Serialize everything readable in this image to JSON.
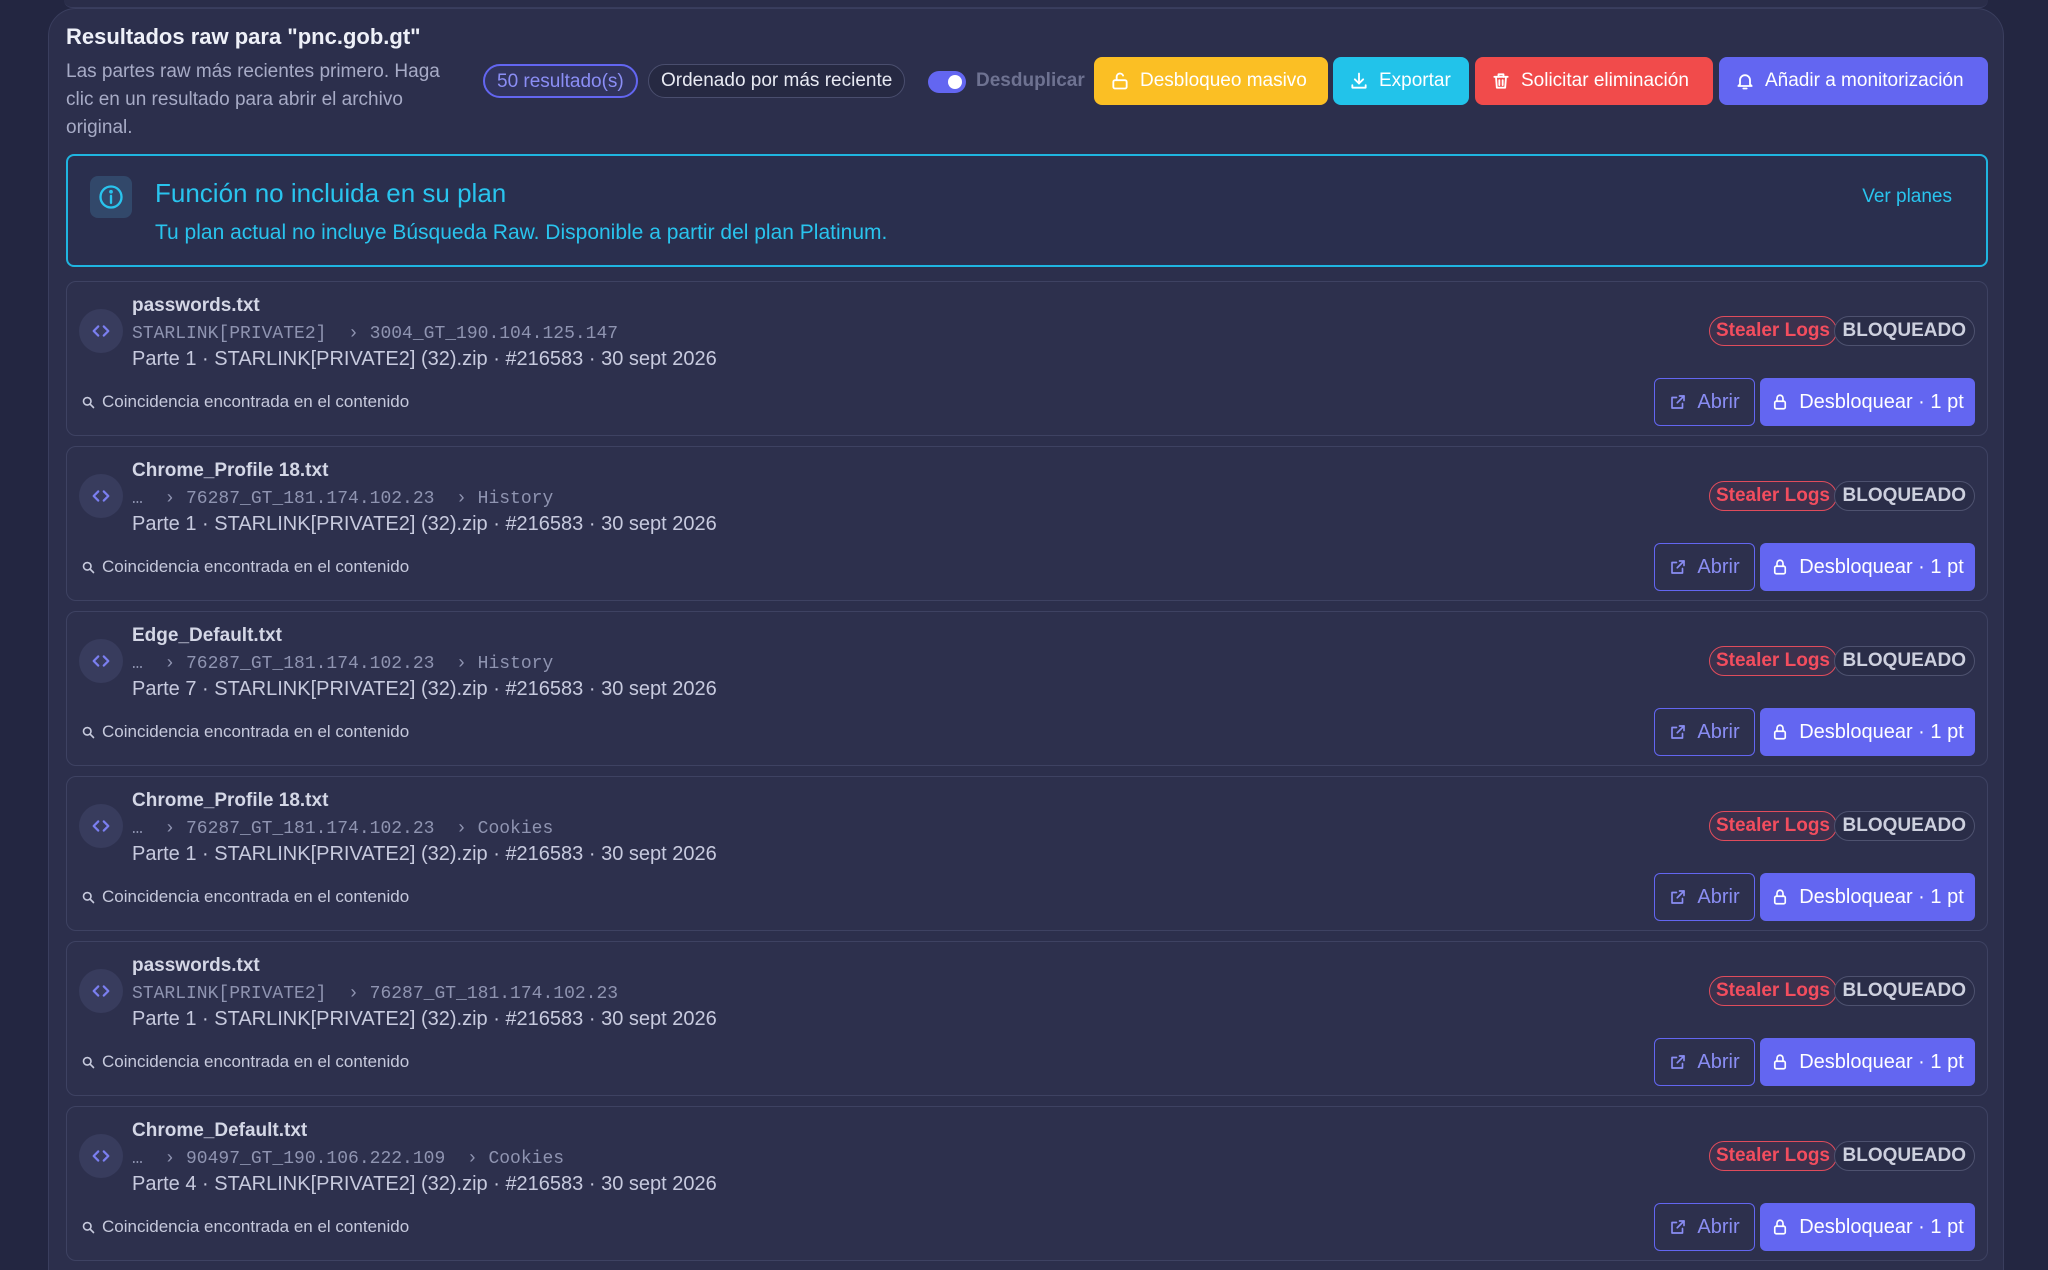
{
  "header": {
    "title": "Resultados raw para \"pnc.gob.gt\"",
    "subtitle": "Las partes raw más recientes primero. Haga clic en un resultado para abrir el archivo original.",
    "count_label": "50 resultado(s)",
    "sort_label": "Ordenado por más reciente",
    "dedup_label": "Desduplicar",
    "dedup_enabled": true,
    "buttons": {
      "bulk_unlock": "Desbloqueo masivo",
      "export": "Exportar",
      "request_delete": "Solicitar eliminación",
      "add_monitor": "Añadir a monitorización"
    }
  },
  "notice": {
    "title": "Función no incluida en su plan",
    "text": "Tu plan actual no incluye Búsqueda Raw. Disponible a partir del plan Platinum.",
    "link": "Ver planes",
    "icon": "info-icon"
  },
  "row_labels": {
    "match": "Coincidencia encontrada en el contenido",
    "source_badge": "Stealer Logs",
    "status_badge": "BLOQUEADO",
    "open": "Abrir",
    "unlock": "Desbloquear · 1 pt"
  },
  "results": [
    {
      "filename": "passwords.txt",
      "path": "STARLINK[PRIVATE2]  › 3004_GT_190.104.125.147",
      "meta": "Parte 1 · STARLINK[PRIVATE2] (32).zip · #216583 · 30 sept 2026"
    },
    {
      "filename": "Chrome_Profile 18.txt",
      "path": "…  › 76287_GT_181.174.102.23  › History",
      "meta": "Parte 1 · STARLINK[PRIVATE2] (32).zip · #216583 · 30 sept 2026"
    },
    {
      "filename": "Edge_Default.txt",
      "path": "…  › 76287_GT_181.174.102.23  › History",
      "meta": "Parte 7 · STARLINK[PRIVATE2] (32).zip · #216583 · 30 sept 2026"
    },
    {
      "filename": "Chrome_Profile 18.txt",
      "path": "…  › 76287_GT_181.174.102.23  › Cookies",
      "meta": "Parte 1 · STARLINK[PRIVATE2] (32).zip · #216583 · 30 sept 2026"
    },
    {
      "filename": "passwords.txt",
      "path": "STARLINK[PRIVATE2]  › 76287_GT_181.174.102.23",
      "meta": "Parte 1 · STARLINK[PRIVATE2] (32).zip · #216583 · 30 sept 2026"
    },
    {
      "filename": "Chrome_Default.txt",
      "path": "…  › 90497_GT_190.106.222.109  › Cookies",
      "meta": "Parte 4 · STARLINK[PRIVATE2] (32).zip · #216583 · 30 sept 2026"
    }
  ],
  "colors": {
    "accent": "#6366f1",
    "info": "#29c4ee",
    "warning": "#fbbf24",
    "danger": "#f14b4b"
  }
}
